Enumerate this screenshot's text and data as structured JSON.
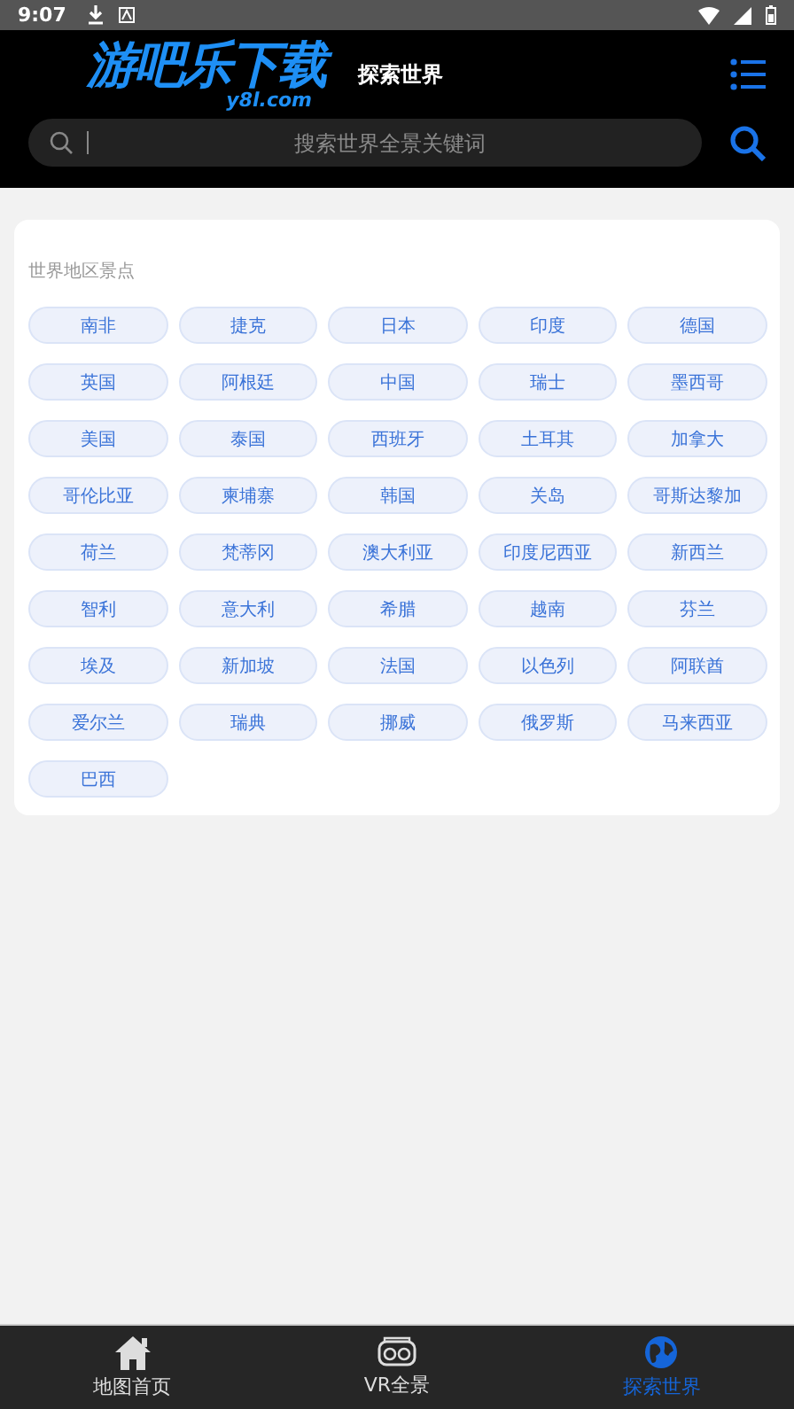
{
  "status_bar": {
    "time": "9:07"
  },
  "header": {
    "logo": {
      "title": "游吧乐下载",
      "domain": "y8l.com"
    },
    "page_title": "探索世界"
  },
  "search": {
    "placeholder": "搜索世界全景关键词"
  },
  "section": {
    "title": "世界地区景点",
    "tags": [
      "南非",
      "捷克",
      "日本",
      "印度",
      "德国",
      "英国",
      "阿根廷",
      "中国",
      "瑞士",
      "墨西哥",
      "美国",
      "泰国",
      "西班牙",
      "土耳其",
      "加拿大",
      "哥伦比亚",
      "柬埔寨",
      "韩国",
      "关岛",
      "哥斯达黎加",
      "荷兰",
      "梵蒂冈",
      "澳大利亚",
      "印度尼西亚",
      "新西兰",
      "智利",
      "意大利",
      "希腊",
      "越南",
      "芬兰",
      "埃及",
      "新加坡",
      "法国",
      "以色列",
      "阿联酋",
      "爱尔兰",
      "瑞典",
      "挪威",
      "俄罗斯",
      "马来西亚",
      "巴西"
    ]
  },
  "tabs": [
    {
      "label": "地图首页",
      "kind": "home",
      "selected": false
    },
    {
      "label": "VR全景",
      "kind": "vr",
      "selected": false
    },
    {
      "label": "探索世界",
      "kind": "globe",
      "selected": true
    }
  ]
}
